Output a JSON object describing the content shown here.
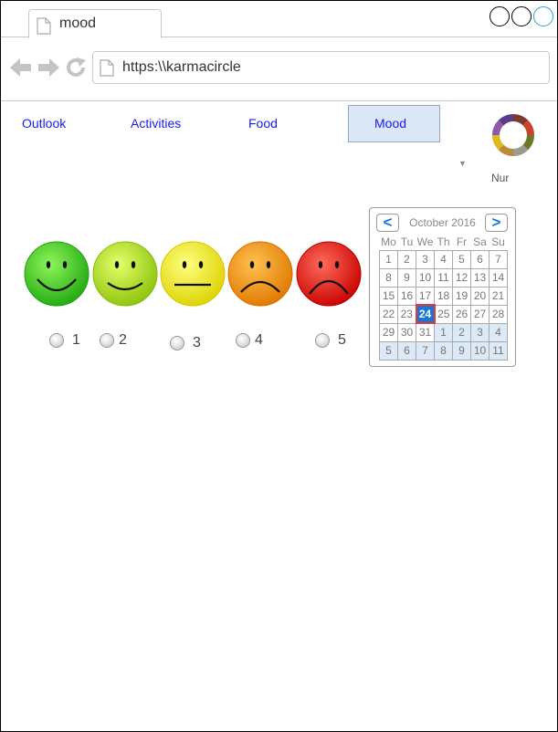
{
  "browser": {
    "tab_title": "mood",
    "url": "https:\\\\karmacircle"
  },
  "nav": {
    "items": [
      {
        "label": "Outlook"
      },
      {
        "label": "Activities"
      },
      {
        "label": "Food"
      },
      {
        "label": "Mood",
        "active": true
      }
    ],
    "user_name": "Nur"
  },
  "mood": {
    "options": [
      {
        "label": "1",
        "face": "very-happy",
        "color": "#3fcf1f"
      },
      {
        "label": "2",
        "face": "happy",
        "color": "#a8e01a"
      },
      {
        "label": "3",
        "face": "neutral",
        "color": "#f0ee12"
      },
      {
        "label": "4",
        "face": "sad",
        "color": "#f5950a"
      },
      {
        "label": "5",
        "face": "very-sad",
        "color": "#e41010"
      }
    ]
  },
  "calendar": {
    "month_label": "October 2016",
    "prev_symbol": "<",
    "next_symbol": ">",
    "weekdays": [
      "Mo",
      "Tu",
      "We",
      "Th",
      "Fr",
      "Sa",
      "Su"
    ],
    "weeks": [
      [
        "1",
        "2",
        "3",
        "4",
        "5",
        "6",
        "7"
      ],
      [
        "8",
        "9",
        "10",
        "11",
        "12",
        "13",
        "14"
      ],
      [
        "15",
        "16",
        "17",
        "18",
        "19",
        "20",
        "21"
      ],
      [
        "22",
        "23",
        "24",
        "25",
        "26",
        "27",
        "28"
      ],
      [
        "29",
        "30",
        "31",
        "1",
        "2",
        "3",
        "4"
      ],
      [
        "5",
        "6",
        "7",
        "8",
        "9",
        "10",
        "11"
      ]
    ],
    "selected_day": "24",
    "accent_color": "#1976d2",
    "selected_border_color": "#e53935"
  }
}
